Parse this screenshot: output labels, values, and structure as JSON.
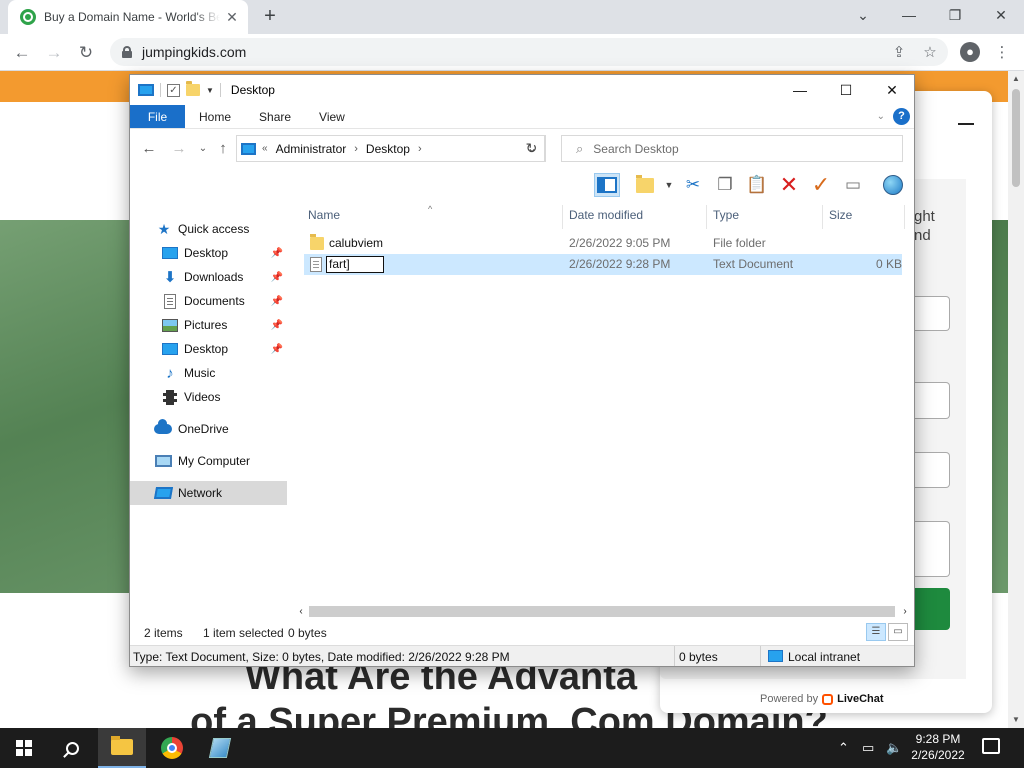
{
  "browser": {
    "tab_title": "Buy a Domain Name - World's Best Domains",
    "url": "jumpingkids.com",
    "new_tab_symbol": "+",
    "tab_close_symbol": "✕"
  },
  "webpage": {
    "heading_line1": "What Are the Advanta",
    "heading_line2": "of a Super Premium .Com Domain?",
    "chat_text_line1": "ght",
    "chat_text_line2": "nd",
    "powered_by": "Powered by",
    "livechat_brand": "LiveChat"
  },
  "explorer": {
    "window_title": "Desktop",
    "ribbon_tabs": {
      "file": "File",
      "home": "Home",
      "share": "Share",
      "view": "View"
    },
    "help_symbol": "?",
    "address": {
      "prefix": "«",
      "crumbs": [
        "Administrator",
        "Desktop"
      ]
    },
    "search_placeholder": "Search Desktop",
    "nav_pane": {
      "quick_access": "Quick access",
      "items": [
        {
          "label": "Desktop",
          "pinned": true
        },
        {
          "label": "Downloads",
          "pinned": true
        },
        {
          "label": "Documents",
          "pinned": true
        },
        {
          "label": "Pictures",
          "pinned": true
        },
        {
          "label": "Desktop",
          "pinned": true
        },
        {
          "label": "Music",
          "pinned": false
        },
        {
          "label": "Videos",
          "pinned": false
        }
      ],
      "onedrive": "OneDrive",
      "my_computer": "My Computer",
      "network": "Network"
    },
    "columns": {
      "name": "Name",
      "date": "Date modified",
      "type": "Type",
      "size": "Size"
    },
    "files": [
      {
        "name": "calubviem",
        "date": "2/26/2022 9:05 PM",
        "type": "File folder",
        "size": ""
      },
      {
        "name": "fart",
        "date": "2/26/2022 9:28 PM",
        "type": "Text Document",
        "size": "0 KB",
        "rename_value": "fart]"
      }
    ],
    "status": {
      "items": "2 items",
      "selected": "1 item selected",
      "bytes": "0 bytes"
    },
    "infobar": {
      "details": "Type: Text Document, Size: 0 bytes, Date modified: 2/26/2022 9:28 PM",
      "size": "0 bytes",
      "zone": "Local intranet"
    }
  },
  "taskbar": {
    "time": "9:28 PM",
    "date": "2/26/2022"
  },
  "colors": {
    "accent_blue": "#1a6fc9",
    "orange_bar": "#f39a2f",
    "hero_green": "#5f8e5e",
    "selection": "#cce8ff"
  }
}
